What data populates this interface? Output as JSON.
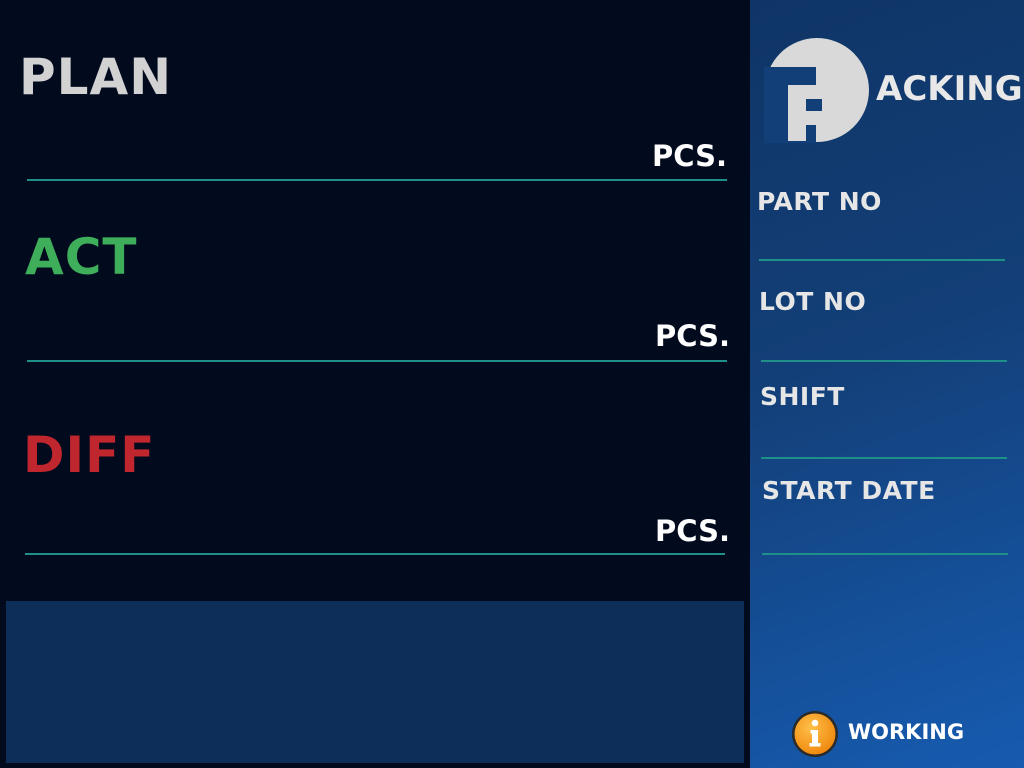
{
  "colors": {
    "plan": "#d2d2d2",
    "act": "#3fae5a",
    "diff": "#c0262d",
    "rule": "#1f8f8a",
    "status_icon": "#f39a1e"
  },
  "metrics": {
    "plan": {
      "label": "PLAN",
      "value": "",
      "unit": "PCS."
    },
    "act": {
      "label": "ACT",
      "value": "",
      "unit": "PCS."
    },
    "diff": {
      "label": "DIFF",
      "value": "",
      "unit": "PCS."
    }
  },
  "message": "",
  "sidebar": {
    "logo_letter": "P",
    "brand_text": "ACKING",
    "fields": {
      "part_no": {
        "label": "PART NO",
        "value": ""
      },
      "lot_no": {
        "label": "LOT NO",
        "value": ""
      },
      "shift": {
        "label": "SHIFT",
        "value": ""
      },
      "start_date": {
        "label": "START DATE",
        "value": ""
      }
    },
    "status": {
      "icon": "info-icon",
      "text": "WORKING"
    }
  }
}
